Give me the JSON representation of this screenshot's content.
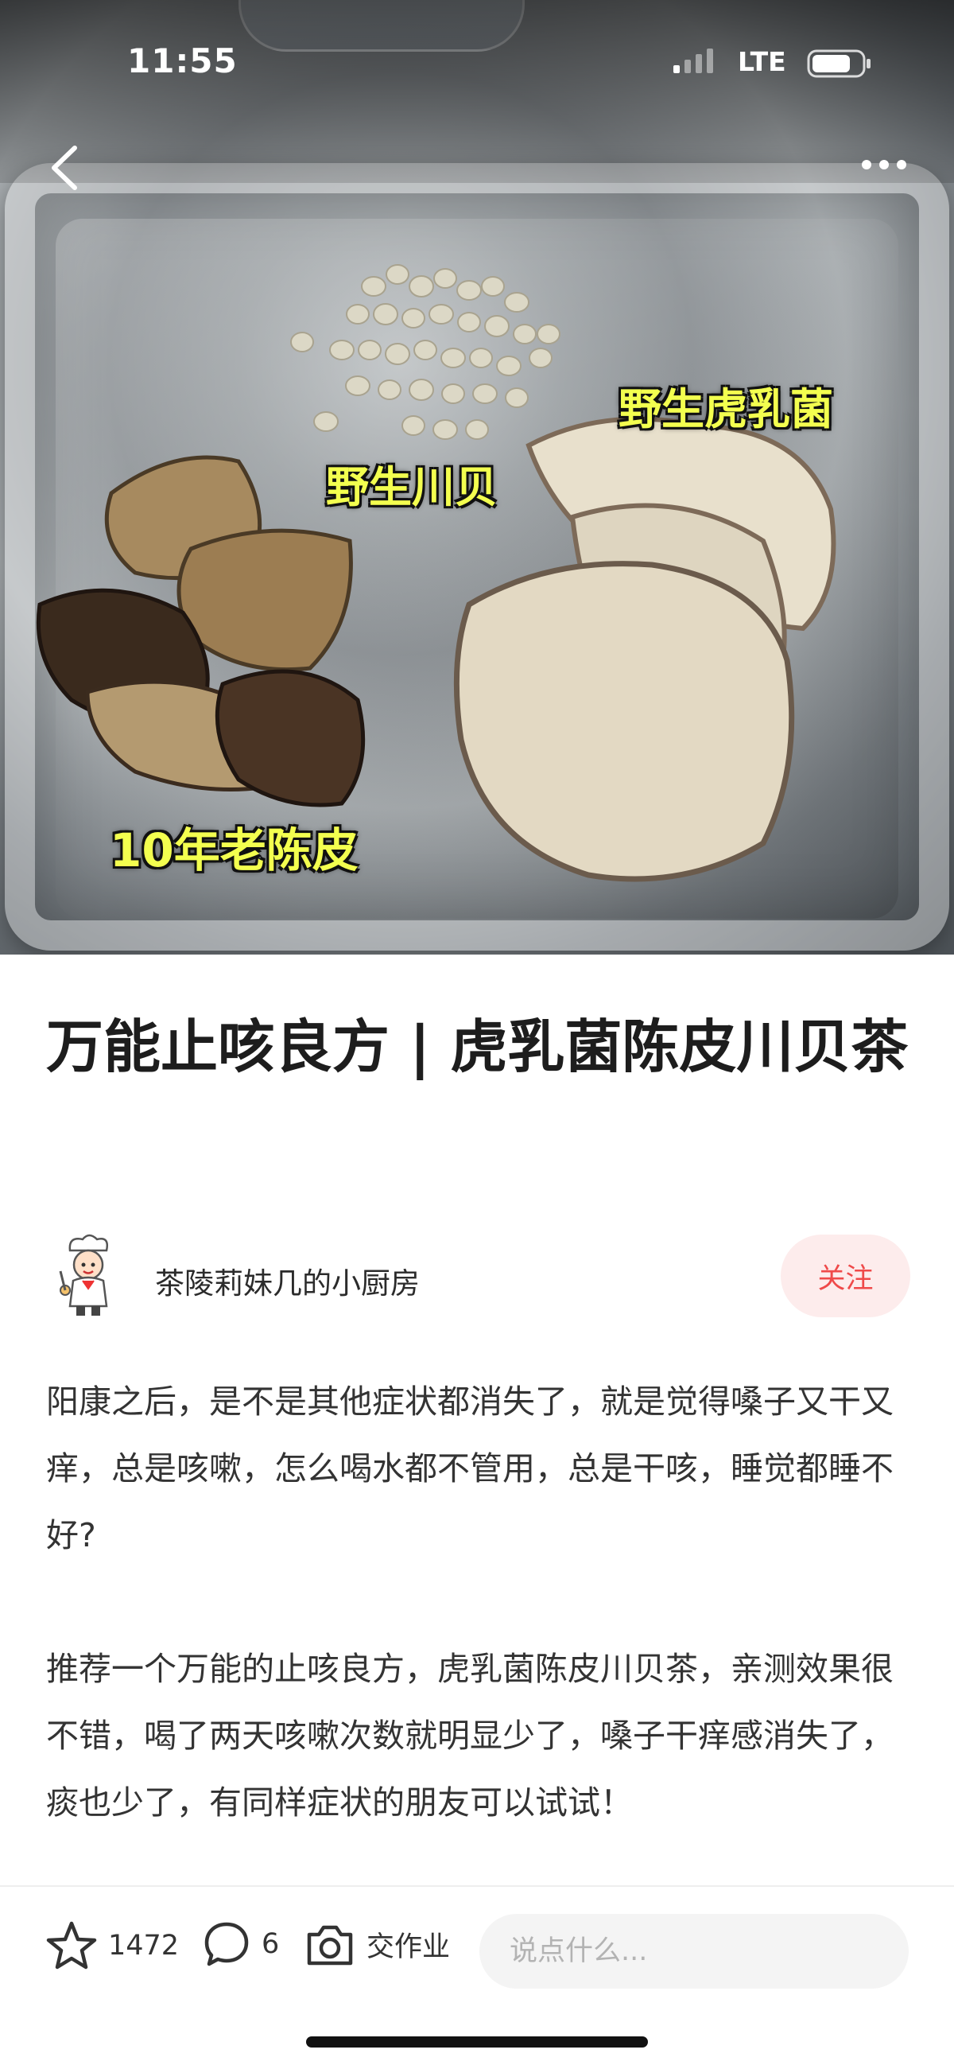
{
  "status_bar": {
    "time": "11:55",
    "network": "LTE"
  },
  "photo": {
    "labels": {
      "chuanbei": "野生川贝",
      "hurujun": "野生虎乳菌",
      "chenpi": "10年老陈皮"
    },
    "icons": {
      "back": "back-arrow-icon",
      "more": "more-dots-icon"
    }
  },
  "article": {
    "title": "万能止咳良方 | 虎乳菌陈皮川贝茶",
    "author": {
      "name": "茶陵莉妹几的小厨房",
      "follow_label": "关注"
    },
    "paragraphs": [
      "阳康之后，是不是其他症状都消失了，就是觉得嗓子又干又痒，总是咳嗽，怎么喝水都不管用，总是干咳，睡觉都睡不好?",
      "推荐一个万能的止咳良方，虎乳菌陈皮川贝茶，亲测效果很不错，喝了两天咳嗽次数就明显少了，嗓子干痒感消失了，痰也少了，有同样症状的朋友可以试试！"
    ]
  },
  "bottom_bar": {
    "star_count": "1472",
    "comment_count": "6",
    "homework_label": "交作业",
    "comment_placeholder": "说点什么..."
  },
  "colors": {
    "follow_text": "#ef4a4a",
    "follow_bg": "#fdecec",
    "label_fill": "#f3ff4f"
  }
}
